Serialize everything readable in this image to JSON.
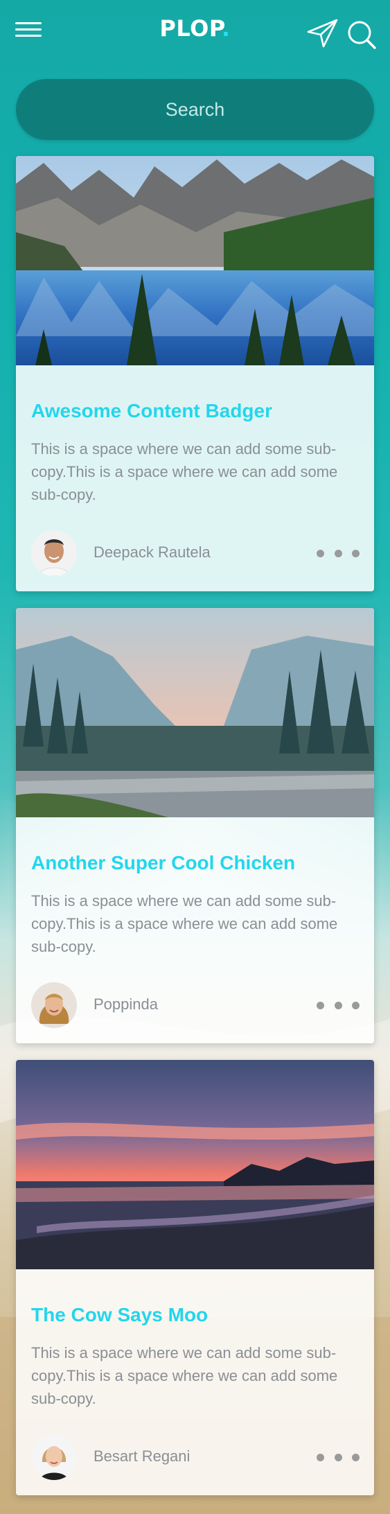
{
  "header": {
    "brand": "PLOP",
    "brand_dot": ".",
    "menu_icon": "hamburger-menu-icon",
    "send_icon": "paper-plane-icon",
    "search_icon": "search-icon"
  },
  "search": {
    "placeholder": "Search"
  },
  "colors": {
    "accent": "#22d6ec",
    "search_bg": "#0f7b78",
    "text_muted": "#8a8f94"
  },
  "cards": [
    {
      "title": "Awesome Content Badger",
      "copy": "This is a space where we can add some sub-copy.This is a space where we can add some sub-copy.",
      "author": "Deepack Rautela",
      "image": "mountain-lake-photo",
      "avatar": "man-portrait"
    },
    {
      "title": "Another Super Cool Chicken",
      "copy": "This is a space where we can add some sub-copy.This is a space where we can add some sub-copy.",
      "author": "Poppinda",
      "image": "valley-river-photo",
      "avatar": "woman-portrait"
    },
    {
      "title": "The Cow Says Moo",
      "copy": "This is a space where we can add some sub-copy.This is a space where we can add some sub-copy.",
      "author": "Besart Regani",
      "image": "beach-sunset-photo",
      "avatar": "woman-portrait"
    }
  ]
}
